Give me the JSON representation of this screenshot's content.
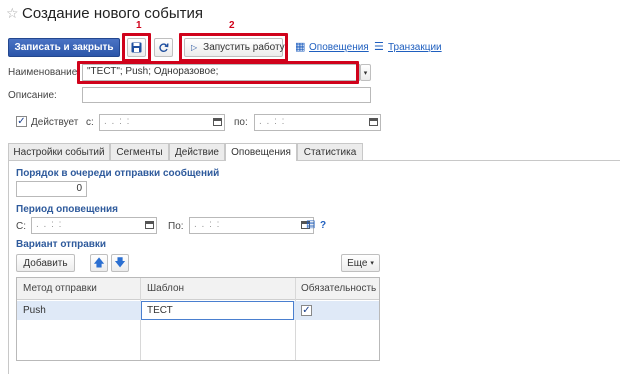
{
  "window": {
    "title": "Создание нового события"
  },
  "toolbar": {
    "save_close_label": "Записать и закрыть",
    "save_icon": "floppy-disk-icon",
    "refresh_icon": "refresh-icon",
    "run_label": "Запустить работу",
    "notifications_link": "Оповещения",
    "transactions_link": "Транзакции"
  },
  "annotations": {
    "marker_1": "1",
    "marker_2": "2",
    "color": "#d0021b"
  },
  "form": {
    "name_label": "Наименование:",
    "name_value": "\"ТЕСТ\"; Push; Одноразовое;",
    "description_label": "Описание:",
    "description_value": "",
    "active_label": "Действует",
    "active_checked": true,
    "from_label": "с:",
    "to_label": "по:",
    "date_mask": ". .   : :"
  },
  "tabs": [
    {
      "label": "Настройки событий",
      "active": false
    },
    {
      "label": "Сегменты",
      "active": false
    },
    {
      "label": "Действие",
      "active": false
    },
    {
      "label": "Оповещения",
      "active": true
    },
    {
      "label": "Статистика",
      "active": false
    }
  ],
  "notifications": {
    "order_title": "Порядок в очереди отправки сообщений",
    "order_value": "0",
    "period_title": "Период оповещения",
    "from_label": "С:",
    "to_label": "По:",
    "help": "?",
    "variant_title": "Вариант отправки",
    "add_label": "Добавить",
    "more_label": "Еще",
    "columns": [
      "Метод отправки",
      "Шаблон",
      "Обязательность"
    ],
    "rows": [
      {
        "method": "Push",
        "template": "ТЕСТ",
        "required": true
      }
    ]
  },
  "colors": {
    "accent": "#2b56aa",
    "link": "#1f5fbf",
    "section": "#2e5a9c",
    "selected_row": "#dfe9f7"
  }
}
